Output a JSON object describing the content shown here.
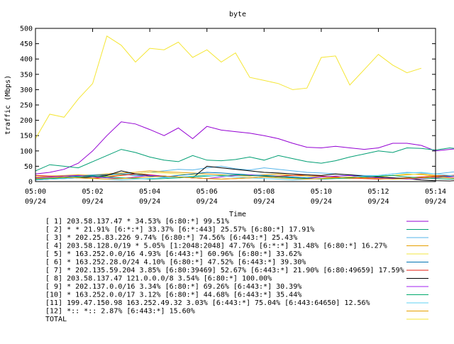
{
  "chart_data": {
    "type": "line",
    "title": "byte",
    "xlabel": "Time",
    "ylabel": "traffic (Mbps)",
    "ylim": [
      0,
      500
    ],
    "yticks": [
      "0",
      "50",
      "100",
      "150",
      "200",
      "250",
      "300",
      "350",
      "400",
      "450",
      "500"
    ],
    "xticks": [
      {
        "time": "05:00",
        "date": "09/24"
      },
      {
        "time": "05:02",
        "date": "09/24"
      },
      {
        "time": "05:04",
        "date": "09/24"
      },
      {
        "time": "05:06",
        "date": "09/24"
      },
      {
        "time": "05:08",
        "date": "09/24"
      },
      {
        "time": "05:10",
        "date": "09/24"
      },
      {
        "time": "05:12",
        "date": "09/24"
      },
      {
        "time": "05:14",
        "date": "09/24"
      }
    ],
    "x_range_minutes": [
      0,
      14
    ],
    "x_step_minutes": 0.5,
    "grid": false,
    "legend_position": "bottom",
    "series": [
      {
        "name": "[ 1] 203.58.137.47 * 34.53%  [6:80:*] 99.51%",
        "color": "#9400d3",
        "values": [
          25,
          30,
          40,
          60,
          100,
          150,
          195,
          188,
          170,
          150,
          175,
          140,
          180,
          168,
          163,
          158,
          150,
          140,
          125,
          112,
          110,
          115,
          110,
          105,
          110,
          125,
          125,
          118,
          100,
          105,
          110,
          120,
          122,
          118,
          120,
          120,
          115,
          110,
          120
        ]
      },
      {
        "name": "[ 2] * * 21.91%  [6:*:*] 33.37% [6:*:443] 25.57% [6:80:*] 17.91%",
        "color": "#009e73",
        "values": [
          35,
          55,
          50,
          45,
          65,
          85,
          105,
          95,
          80,
          70,
          65,
          85,
          70,
          68,
          72,
          80,
          70,
          85,
          75,
          65,
          60,
          68,
          80,
          90,
          100,
          95,
          110,
          108,
          103,
          110,
          105,
          95,
          90,
          92,
          95,
          90,
          88,
          90,
          92
        ]
      },
      {
        "name": "[ 3] * 202.25.83.226 9.74%  [6:80:*] 74.56% [6:443:*] 25.43%",
        "color": "#56b4e9",
        "values": [
          10,
          15,
          18,
          20,
          22,
          25,
          28,
          25,
          30,
          35,
          40,
          38,
          45,
          50,
          42,
          38,
          45,
          40,
          35,
          30,
          28,
          25,
          22,
          20,
          20,
          25,
          30,
          28,
          25,
          30,
          35,
          32,
          28,
          30,
          35,
          40,
          55,
          60,
          70
        ]
      },
      {
        "name": "[ 4] 203.58.128.0/19 * 5.05%  [1:2048:2048] 47.76% [6:*:*] 31.48% [6:80:*] 16.27%",
        "color": "#e69f00",
        "values": [
          15,
          18,
          20,
          22,
          20,
          25,
          28,
          30,
          35,
          32,
          30,
          28,
          25,
          22,
          20,
          18,
          22,
          25,
          20,
          18,
          15,
          12,
          10,
          12,
          15,
          20,
          22,
          25,
          20,
          18,
          15,
          18,
          20,
          22,
          25,
          28,
          30,
          32,
          35
        ]
      },
      {
        "name": "[ 5] * 163.252.0.0/16 4.93%  [6:443:*] 60.96% [6:80:*] 33.62%",
        "color": "#f0e442",
        "values": [
          8,
          10,
          12,
          15,
          12,
          18,
          22,
          25,
          30,
          28,
          25,
          22,
          20,
          18,
          15,
          12,
          15,
          18,
          20,
          22,
          18,
          15,
          12,
          10,
          15,
          20,
          25,
          22,
          18,
          15,
          20,
          25,
          28,
          30,
          32,
          35,
          30,
          25,
          20
        ]
      },
      {
        "name": "[ 6] * 163.252.28.0/24 4.10%  [6:80:*] 47.52% [6:443:*] 39.30%",
        "color": "#0072b2",
        "values": [
          10,
          12,
          15,
          18,
          20,
          22,
          25,
          20,
          18,
          15,
          20,
          25,
          30,
          28,
          25,
          22,
          20,
          18,
          15,
          12,
          15,
          18,
          20,
          18,
          15,
          12,
          10,
          12,
          15,
          18,
          20,
          18,
          15,
          12,
          10,
          12,
          15,
          18,
          20
        ]
      },
      {
        "name": "[ 7] * 202.135.59.204 3.85%  [6:80:39469] 52.67% [6:443:*] 21.90% [6:80:49659] 17.59%",
        "color": "#e51e10",
        "values": [
          20,
          18,
          15,
          12,
          10,
          15,
          20,
          25,
          22,
          18,
          15,
          12,
          10,
          8,
          10,
          12,
          15,
          18,
          20,
          22,
          18,
          15,
          12,
          10,
          8,
          10,
          12,
          15,
          18,
          20,
          22,
          25,
          20,
          18,
          15,
          20,
          25,
          28,
          30
        ]
      },
      {
        "name": "[ 8] 203.58.137.47 121.0.0.0/8 3.54%  [6:80:*] 100.00%",
        "color": "#000000",
        "values": [
          5,
          8,
          10,
          12,
          15,
          20,
          35,
          25,
          20,
          18,
          15,
          12,
          50,
          45,
          40,
          35,
          30,
          28,
          25,
          22,
          20,
          25,
          22,
          18,
          15,
          12,
          10,
          5,
          3,
          2,
          5,
          8,
          10,
          12,
          15,
          10,
          8,
          5,
          3
        ]
      },
      {
        "name": "[ 9] * 202.137.0.0/16 3.34%  [6:80:*] 69.26% [6:443:*] 30.39%",
        "color": "#a020f0",
        "values": [
          12,
          15,
          18,
          20,
          15,
          12,
          10,
          15,
          20,
          18,
          15,
          12,
          10,
          15,
          20,
          22,
          18,
          15,
          12,
          10,
          15,
          18,
          20,
          15,
          12,
          10,
          8,
          10,
          12,
          15,
          18,
          20,
          22,
          18,
          15,
          12,
          10,
          8,
          5
        ]
      },
      {
        "name": "[10] * 163.252.0.0/17 3.12%  [6:80:*] 44.68% [6:443:*] 35.44%",
        "color": "#00a86b",
        "values": [
          8,
          10,
          12,
          15,
          18,
          15,
          12,
          10,
          8,
          10,
          12,
          15,
          18,
          20,
          22,
          20,
          18,
          15,
          12,
          10,
          8,
          10,
          12,
          15,
          18,
          20,
          15,
          12,
          10,
          8,
          10,
          12,
          15,
          18,
          15,
          12,
          10,
          8,
          10
        ]
      },
      {
        "name": "[11] 199.47.150.98 163.252.49.32 3.03%  [6:443:*] 75.04% [6:443:64650] 12.56%",
        "color": "#5fd3f3",
        "values": [
          5,
          8,
          10,
          12,
          10,
          8,
          5,
          8,
          10,
          12,
          15,
          18,
          20,
          18,
          15,
          12,
          10,
          8,
          5,
          8,
          10,
          12,
          15,
          18,
          20,
          25,
          28,
          30,
          25,
          20,
          15,
          12,
          10,
          12,
          15,
          18,
          20,
          15,
          12
        ]
      },
      {
        "name": "[12] *:: *:: 2.87%  [6:443:*] 15.60%",
        "color": "#e6a000",
        "values": [
          10,
          12,
          15,
          12,
          10,
          8,
          10,
          12,
          15,
          18,
          15,
          12,
          10,
          8,
          10,
          12,
          15,
          12,
          10,
          8,
          10,
          12,
          15,
          12,
          10,
          8,
          10,
          12,
          15,
          12,
          10,
          8,
          10,
          12,
          15,
          12,
          10,
          8,
          10
        ]
      },
      {
        "name": "TOTAL",
        "color": "#f5e635",
        "values": [
          140,
          220,
          210,
          270,
          320,
          475,
          445,
          390,
          435,
          430,
          455,
          405,
          430,
          390,
          420,
          340,
          330,
          320,
          300,
          305,
          405,
          410,
          315,
          365,
          415,
          380,
          355,
          370
        ]
      }
    ]
  }
}
